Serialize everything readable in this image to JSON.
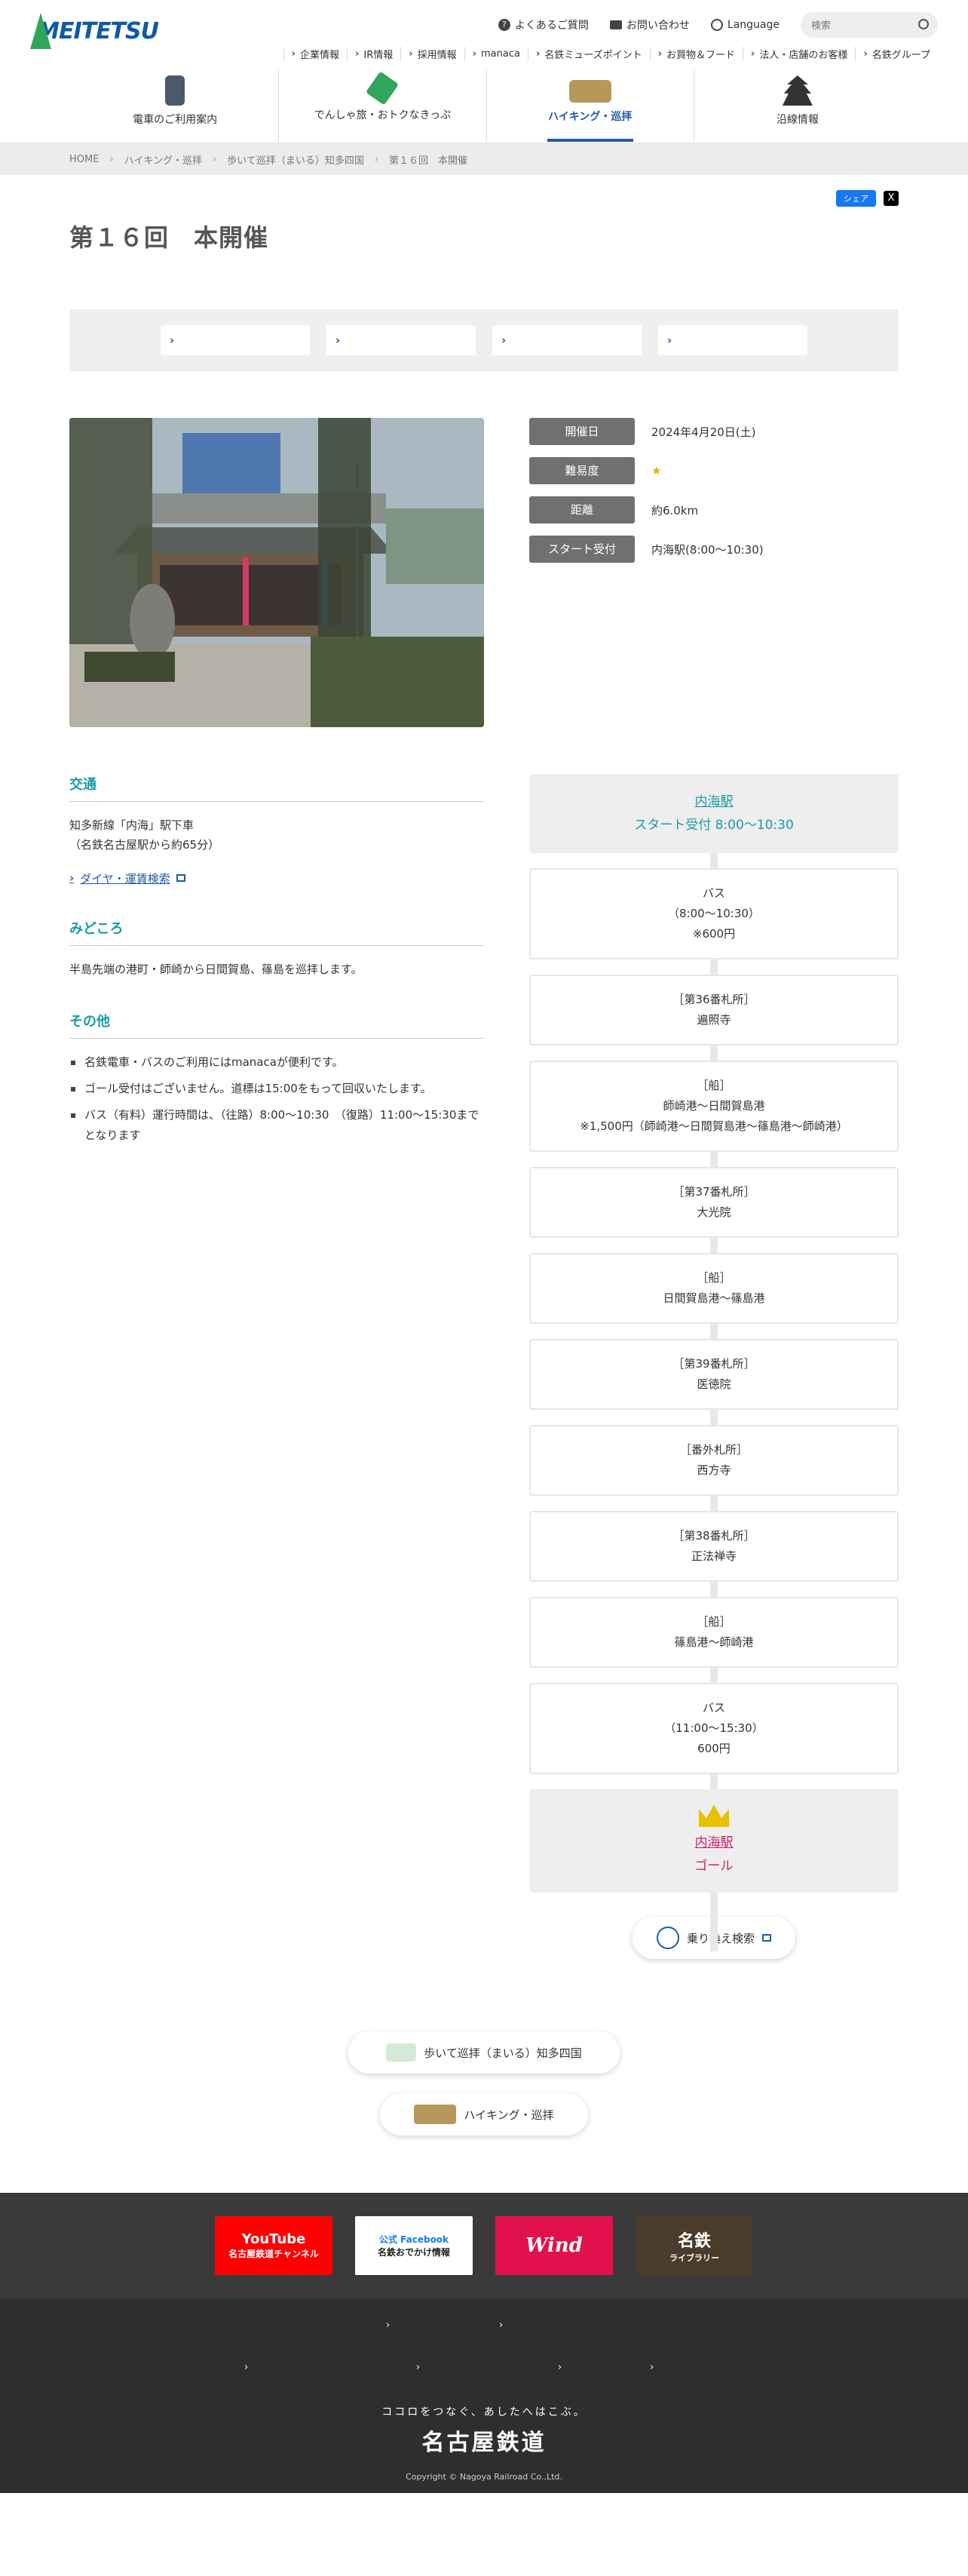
{
  "header": {
    "logo": "MEITETSU",
    "utility": [
      "よくあるご質問",
      "お問い合わせ",
      "Language"
    ],
    "search_placeholder": "検索",
    "subnav": [
      "企業情報",
      "IR情報",
      "採用情報",
      "manaca",
      "名鉄ミューズポイント",
      "お買物＆フード",
      "法人・店舗のお客様",
      "名鉄グループ"
    ],
    "gnav": [
      "電車のご利用案内",
      "でんしゃ旅・おトクなきっぷ",
      "ハイキング・巡拝",
      "沿線情報"
    ]
  },
  "breadcrumb": [
    "HOME",
    "ハイキング・巡拝",
    "歩いて巡拝（まいる）知多四国",
    "第１６回　本開催"
  ],
  "share": {
    "facebook": "シェア",
    "x": "X"
  },
  "page_title": "第１６回　本開催",
  "tabs": [
    "",
    "",
    "",
    ""
  ],
  "meta": [
    {
      "label": "開催日",
      "value": "2024年4月20日(土)"
    },
    {
      "label": "難易度",
      "value": "★"
    },
    {
      "label": "距離",
      "value": "約6.0km"
    },
    {
      "label": "スタート受付",
      "value": "内海駅(8:00〜10:30)"
    }
  ],
  "access": {
    "heading": "交通",
    "text1": "知多新線「内海」駅下車",
    "text2": "（名鉄名古屋駅から約65分）",
    "link": "ダイヤ・運賃検索"
  },
  "highlights": {
    "heading": "みどころ",
    "text": "半島先端の港町・師崎から日間賀島、篠島を巡拝します。"
  },
  "other": {
    "heading": "その他",
    "items": [
      "名鉄電車・バスのご利用にはmanacaが便利です。",
      "ゴール受付はございません。道標は15:00をもって回収いたします。",
      "バス（有料）運行時間は、（往路）8:00〜10:30　（復路）11:00〜15:30までとなります"
    ]
  },
  "route": {
    "start_station": "内海駅",
    "start_text": "スタート受付 8:00〜10:30",
    "nodes": [
      [
        "バス",
        "（8:00〜10:30）",
        "※600円"
      ],
      [
        "［第36番札所］",
        "遍照寺"
      ],
      [
        "［船］",
        "師崎港〜日間賀島港",
        "※1,500円（師崎港〜日間賀島港〜篠島港〜師崎港）"
      ],
      [
        "［第37番札所］",
        "大光院"
      ],
      [
        "［船］",
        "日間賀島港〜篠島港"
      ],
      [
        "［第39番札所］",
        "医徳院"
      ],
      [
        "［番外札所］",
        "西方寺"
      ],
      [
        "［第38番札所］",
        "正法禅寺"
      ],
      [
        "［船］",
        "篠島港〜師崎港"
      ],
      [
        "バス",
        "（11:00〜15:30）",
        "600円"
      ]
    ],
    "goal_station": "内海駅",
    "goal_text": "ゴール",
    "transfer_button": "乗り換え検索"
  },
  "bottom_links": [
    "歩いて巡拝（まいる）知多四国",
    "ハイキング・巡拝"
  ],
  "banners": [
    "YouTube",
    "名古屋鉄道チャンネル",
    "公式 Facebook",
    "名鉄おでかけ情報",
    "Wind",
    "名鉄",
    "ライブラリー"
  ],
  "footer": {
    "tagline": "ココロをつなぐ、あしたへはこぶ。",
    "corp": "名古屋鉄道",
    "copyright": "Copyright © Nagoya Railroad Co.,Ltd."
  }
}
